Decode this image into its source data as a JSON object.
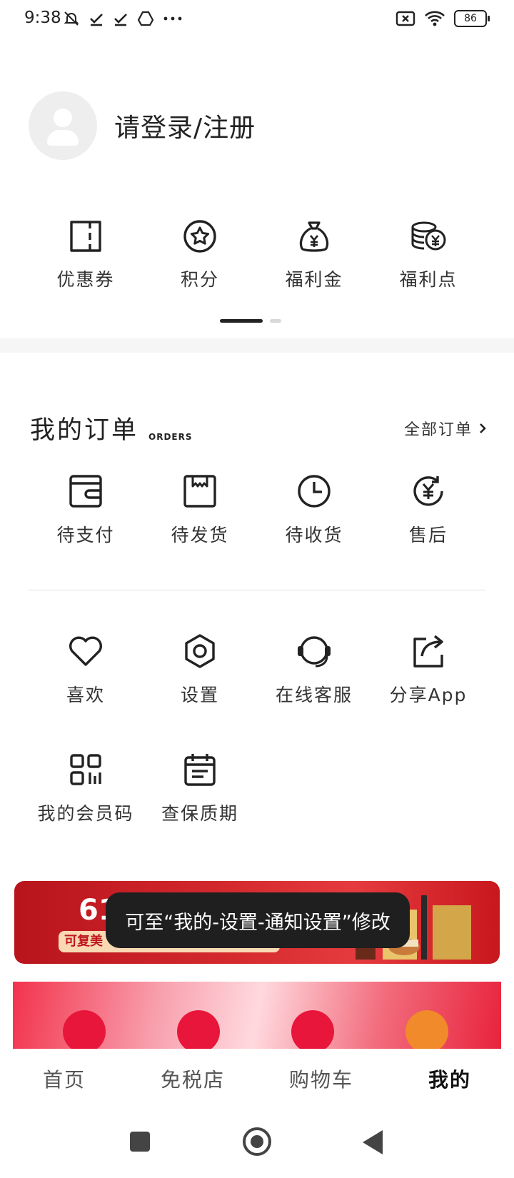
{
  "status_bar": {
    "time": "9:38",
    "battery": "86",
    "icons": [
      "mute-icon",
      "check-icon",
      "check-icon",
      "drive-icon",
      "more-icon",
      "screen-cancel-icon",
      "wifi-icon",
      "battery-icon"
    ]
  },
  "profile": {
    "login_text": "请登录/注册"
  },
  "assets": [
    {
      "label": "优惠券",
      "icon": "coupon-icon"
    },
    {
      "label": "积分",
      "icon": "star-badge-icon"
    },
    {
      "label": "福利金",
      "icon": "money-bag-icon"
    },
    {
      "label": "福利点",
      "icon": "coins-icon"
    }
  ],
  "assets_pager": {
    "pages": 2,
    "current": 1
  },
  "orders": {
    "title": "我的订单",
    "subtitle": "ORDERS",
    "all_label": "全部订单",
    "items": [
      {
        "label": "待支付",
        "icon": "wallet-icon"
      },
      {
        "label": "待发货",
        "icon": "package-icon"
      },
      {
        "label": "待收货",
        "icon": "clock-icon"
      },
      {
        "label": "售后",
        "icon": "refund-icon"
      }
    ]
  },
  "services": {
    "row1": [
      {
        "label": "喜欢",
        "icon": "heart-icon"
      },
      {
        "label": "设置",
        "icon": "hexagon-settings-icon"
      },
      {
        "label": "在线客服",
        "icon": "headset-icon"
      },
      {
        "label": "分享App",
        "icon": "share-icon"
      }
    ],
    "row2": [
      {
        "label": "我的会员码",
        "icon": "qrcode-icon"
      },
      {
        "label": "查保质期",
        "icon": "calendar-icon"
      }
    ]
  },
  "banner": {
    "number_fragment": "61",
    "pill_text": "可复美"
  },
  "toast": {
    "text": "可至“我的-设置-通知设置”修改"
  },
  "tabbar": {
    "tabs": [
      {
        "label": "首页",
        "active": false
      },
      {
        "label": "免税店",
        "active": false
      },
      {
        "label": "购物车",
        "active": false
      },
      {
        "label": "我的",
        "active": true
      }
    ]
  },
  "colors": {
    "brand_red": "#c8181e",
    "text_dark": "#222222",
    "toast_bg": "#1f1f1f"
  }
}
